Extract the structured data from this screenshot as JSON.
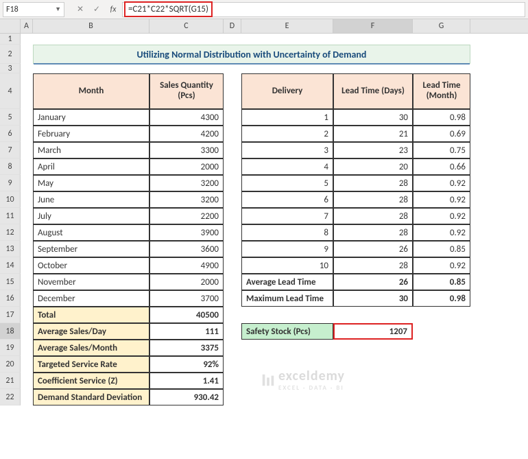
{
  "formula_bar": {
    "cell_ref": "F18",
    "formula": "=C21*C22*SQRT(G15)",
    "cancel": "✕",
    "confirm": "✓",
    "fx": "fx"
  },
  "columns": [
    "A",
    "B",
    "C",
    "D",
    "E",
    "F",
    "G"
  ],
  "title": "Utilizing Normal Distribution with Uncertainty of Demand",
  "table1": {
    "head_month": "Month",
    "head_qty": "Sales Quantity (Pcs)",
    "rows": [
      {
        "m": "January",
        "q": "4300"
      },
      {
        "m": "February",
        "q": "4200"
      },
      {
        "m": "March",
        "q": "3300"
      },
      {
        "m": "April",
        "q": "2000"
      },
      {
        "m": "May",
        "q": "3200"
      },
      {
        "m": "June",
        "q": "3200"
      },
      {
        "m": "July",
        "q": "2200"
      },
      {
        "m": "August",
        "q": "3900"
      },
      {
        "m": "September",
        "q": "3600"
      },
      {
        "m": "October",
        "q": "4900"
      },
      {
        "m": "November",
        "q": "2000"
      },
      {
        "m": "December",
        "q": "3700"
      }
    ],
    "summary": [
      {
        "label": "Total",
        "val": "40500"
      },
      {
        "label": "Average Sales/Day",
        "val": "111"
      },
      {
        "label": "Average Sales/Month",
        "val": "3375"
      },
      {
        "label": "Targeted Service Rate",
        "val": "92%"
      },
      {
        "label": "Coefficient Service (Z)",
        "val": "1.41"
      },
      {
        "label": "Demand Standard Deviation",
        "val": "930.42"
      }
    ]
  },
  "table2": {
    "head_delivery": "Delivery",
    "head_days": "Lead Time (Days)",
    "head_month": "Lead Time (Month)",
    "rows": [
      {
        "d": "1",
        "days": "30",
        "mo": "0.98"
      },
      {
        "d": "2",
        "days": "21",
        "mo": "0.69"
      },
      {
        "d": "3",
        "days": "23",
        "mo": "0.75"
      },
      {
        "d": "4",
        "days": "20",
        "mo": "0.66"
      },
      {
        "d": "5",
        "days": "28",
        "mo": "0.92"
      },
      {
        "d": "6",
        "days": "28",
        "mo": "0.92"
      },
      {
        "d": "7",
        "days": "28",
        "mo": "0.92"
      },
      {
        "d": "8",
        "days": "28",
        "mo": "0.92"
      },
      {
        "d": "9",
        "days": "26",
        "mo": "0.85"
      },
      {
        "d": "10",
        "days": "28",
        "mo": "0.92"
      }
    ],
    "avg_label": "Average Lead Time",
    "avg_days": "26",
    "avg_mo": "0.85",
    "max_label": "Maximum Lead Time",
    "max_days": "30",
    "max_mo": "0.98"
  },
  "safety": {
    "label": "Safety Stock (Pcs)",
    "value": "1207"
  },
  "watermark": {
    "brand": "exceldemy",
    "tag": "EXCEL · DATA · BI"
  },
  "chart_data": {
    "type": "table",
    "title": "Utilizing Normal Distribution with Uncertainty of Demand",
    "sales": {
      "months": [
        "January",
        "February",
        "March",
        "April",
        "May",
        "June",
        "July",
        "August",
        "September",
        "October",
        "November",
        "December"
      ],
      "quantity_pcs": [
        4300,
        4200,
        3300,
        2000,
        3200,
        3200,
        2200,
        3900,
        3600,
        4900,
        2000,
        3700
      ],
      "total": 40500,
      "avg_per_day": 111,
      "avg_per_month": 3375,
      "targeted_service_rate": 0.92,
      "coefficient_z": 1.41,
      "demand_std_dev": 930.42
    },
    "delivery": {
      "delivery_no": [
        1,
        2,
        3,
        4,
        5,
        6,
        7,
        8,
        9,
        10
      ],
      "lead_time_days": [
        30,
        21,
        23,
        20,
        28,
        28,
        28,
        28,
        26,
        28
      ],
      "lead_time_month": [
        0.98,
        0.69,
        0.75,
        0.66,
        0.92,
        0.92,
        0.92,
        0.92,
        0.85,
        0.92
      ],
      "average_days": 26,
      "average_month": 0.85,
      "maximum_days": 30,
      "maximum_month": 0.98
    },
    "safety_stock_pcs": 1207,
    "formula": "=C21*C22*SQRT(G15)"
  }
}
